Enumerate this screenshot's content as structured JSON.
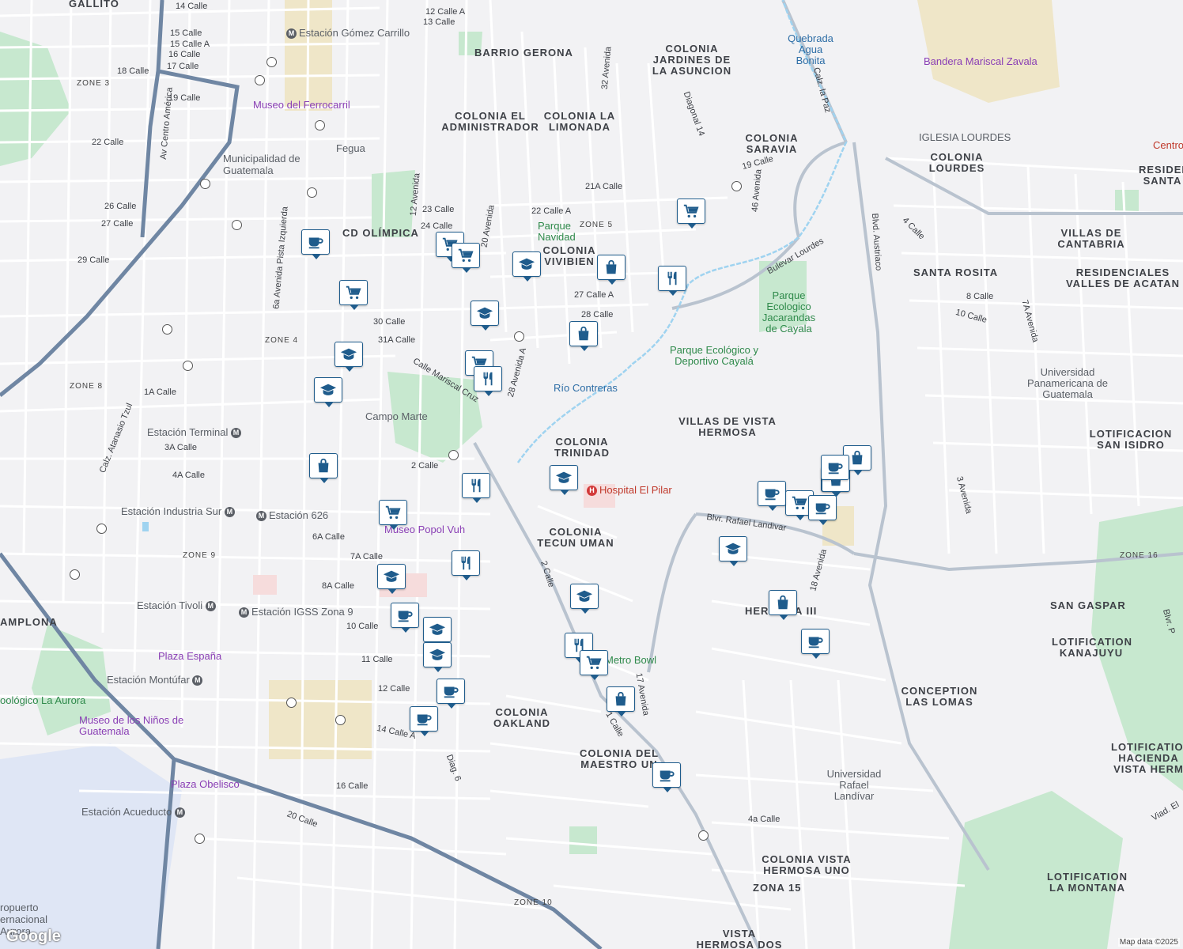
{
  "map": {
    "attribution": "Map data ©2025",
    "logo": "Google",
    "colors": {
      "background": "#f2f2f4",
      "park": "#c7e8cf",
      "water": "#9fd3f0",
      "highway": "#6f86a3",
      "pin_border": "#1f5c8c",
      "hospital": "#c0392b",
      "museum": "#8a3fb5"
    }
  },
  "areas": [
    {
      "id": "barrio-gerona",
      "text": "BARRIO GERONA"
    },
    {
      "id": "colonia-jardines",
      "text": "COLONIA JARDINES DE LA ASUNCION"
    },
    {
      "id": "colonia-administrador",
      "text": "COLONIA EL ADMINISTRADOR"
    },
    {
      "id": "colonia-limonada",
      "text": "COLONIA LA LIMONADA"
    },
    {
      "id": "colonia-saravia",
      "text": "COLONIA SARAVIA"
    },
    {
      "id": "colonia-lourdes",
      "text": "COLONIA LOURDES"
    },
    {
      "id": "residen-santa",
      "text": "RESIDEN SANTA"
    },
    {
      "id": "villas-cantabria",
      "text": "VILLAS DE CANTABRIA"
    },
    {
      "id": "santa-rosita",
      "text": "SANTA ROSITA"
    },
    {
      "id": "valles-acatan",
      "text": "RESIDENCIALES VALLES DE ACATAN"
    },
    {
      "id": "cd-olimpica",
      "text": "CD OLÍMPICA"
    },
    {
      "id": "colonia-vivibien",
      "text": "COLONIA VIVIBIEN"
    },
    {
      "id": "villas-vista",
      "text": "VILLAS DE VISTA HERMOSA"
    },
    {
      "id": "lot-san-isidro",
      "text": "LOTIFICACION SAN ISIDRO"
    },
    {
      "id": "colonia-trinidad",
      "text": "COLONIA TRINIDAD"
    },
    {
      "id": "colonia-tecun",
      "text": "COLONIA TECUN UMAN"
    },
    {
      "id": "hermosa-iii",
      "text": "HERMOSA III"
    },
    {
      "id": "san-gaspar",
      "text": "SAN GASPAR"
    },
    {
      "id": "lot-kanajuyu",
      "text": "LOTIFICATION KANAJUYU"
    },
    {
      "id": "conception-lomas",
      "text": "CONCEPTION LAS LOMAS"
    },
    {
      "id": "colonia-oakland",
      "text": "COLONIA OAKLAND"
    },
    {
      "id": "colonia-maestro",
      "text": "COLONIA DEL MAESTRO UN"
    },
    {
      "id": "lot-hacienda",
      "text": "LOTIFICATION HACIENDA VISTA HERM"
    },
    {
      "id": "colonia-vista-uno",
      "text": "COLONIA VISTA HERMOSA UNO"
    },
    {
      "id": "zona-15",
      "text": "ZONA 15"
    },
    {
      "id": "vista-dos",
      "text": "VISTA HERMOSA DOS"
    },
    {
      "id": "lot-montana",
      "text": "LOTIFICATION LA MONTANA"
    },
    {
      "id": "gallito",
      "text": "GALLITO"
    },
    {
      "id": "amplona",
      "text": "AMPLONA"
    }
  ],
  "pois": [
    {
      "id": "museo-ferrocarril",
      "text": "Museo del Ferrocarril",
      "kind": "museum"
    },
    {
      "id": "municipalidad",
      "text": "Municipalidad de Guatemala",
      "kind": "gov"
    },
    {
      "id": "fegua",
      "text": "Fegua",
      "kind": "transit"
    },
    {
      "id": "estacion-gomez",
      "text": "Estación Gómez Carrillo",
      "kind": "station"
    },
    {
      "id": "estacion-terminal",
      "text": "Estación Terminal",
      "kind": "station"
    },
    {
      "id": "estacion-industria",
      "text": "Estación Industria Sur",
      "kind": "station"
    },
    {
      "id": "estacion-626",
      "text": "Estación 626",
      "kind": "station"
    },
    {
      "id": "estacion-tivoli",
      "text": "Estación Tivoli",
      "kind": "station"
    },
    {
      "id": "estacion-igss",
      "text": "Estación IGSS Zona 9",
      "kind": "station"
    },
    {
      "id": "estacion-montufar",
      "text": "Estación Montúfar",
      "kind": "station"
    },
    {
      "id": "estacion-acueducto",
      "text": "Estación Acueducto",
      "kind": "station"
    },
    {
      "id": "campo-marte",
      "text": "Campo Marte",
      "kind": "park"
    },
    {
      "id": "museo-popol",
      "text": "Museo Popol Vuh",
      "kind": "museum"
    },
    {
      "id": "plaza-espana",
      "text": "Plaza España",
      "kind": "museum"
    },
    {
      "id": "plaza-obelisco",
      "text": "Plaza Obelisco",
      "kind": "museum"
    },
    {
      "id": "museo-ninos",
      "text": "Museo de los Niños de Guatemala",
      "kind": "museum"
    },
    {
      "id": "zoologico",
      "text": "oológico La Aurora",
      "kind": "park"
    },
    {
      "id": "parque-navidad",
      "text": "Parque Navidad",
      "kind": "park"
    },
    {
      "id": "rio-contreras",
      "text": "Río Contreras",
      "kind": "water"
    },
    {
      "id": "quebrada",
      "text": "Quebrada Agua Bonita",
      "kind": "water"
    },
    {
      "id": "parque-jacarandas",
      "text": "Parque Ecologico Jacarandas de Cayala",
      "kind": "park"
    },
    {
      "id": "parque-cayala",
      "text": "Parque Ecológico y Deportivo Cayalá",
      "kind": "park"
    },
    {
      "id": "hospital-pilar",
      "text": "Hospital El Pilar",
      "kind": "hospital"
    },
    {
      "id": "metro-bowl",
      "text": "Metro Bowl",
      "kind": "park"
    },
    {
      "id": "bandera",
      "text": "Bandera Mariscal Zavala",
      "kind": "museum"
    },
    {
      "id": "iglesia-lourdes",
      "text": "IGLESIA LOURDES",
      "kind": "church"
    },
    {
      "id": "upana",
      "text": "Universidad Panamericana de Guatemala",
      "kind": "museum"
    },
    {
      "id": "url",
      "text": "Universidad Rafael Landívar",
      "kind": "school"
    },
    {
      "id": "centro",
      "text": "Centro",
      "kind": "red"
    },
    {
      "id": "aeropuerto",
      "text": "ropuerto ernacional Aurora",
      "kind": "airport"
    }
  ],
  "streets": [
    {
      "id": "s1",
      "text": "14 Calle"
    },
    {
      "id": "s2",
      "text": "12 Calle A"
    },
    {
      "id": "s3",
      "text": "13 Calle"
    },
    {
      "id": "s4",
      "text": "15 Calle"
    },
    {
      "id": "s5",
      "text": "15 Calle A"
    },
    {
      "id": "s6",
      "text": "16 Calle"
    },
    {
      "id": "s7",
      "text": "17 Calle"
    },
    {
      "id": "s8",
      "text": "18 Calle"
    },
    {
      "id": "s9",
      "text": "19 Calle"
    },
    {
      "id": "s10",
      "text": "22 Calle"
    },
    {
      "id": "s11",
      "text": "26 Calle"
    },
    {
      "id": "s12",
      "text": "27 Calle"
    },
    {
      "id": "s13",
      "text": "29 Calle"
    },
    {
      "id": "s14",
      "text": "30 Calle"
    },
    {
      "id": "s15",
      "text": "31A Calle"
    },
    {
      "id": "s16",
      "text": "1A Calle"
    },
    {
      "id": "s17",
      "text": "2 Calle"
    },
    {
      "id": "s18",
      "text": "3A Calle"
    },
    {
      "id": "s19",
      "text": "4A Calle"
    },
    {
      "id": "s20",
      "text": "6A Calle"
    },
    {
      "id": "s21",
      "text": "7A Calle"
    },
    {
      "id": "s22",
      "text": "8A Calle"
    },
    {
      "id": "s23",
      "text": "10 Calle"
    },
    {
      "id": "s24",
      "text": "11 Calle"
    },
    {
      "id": "s25",
      "text": "12 Calle"
    },
    {
      "id": "s26",
      "text": "14 Calle A"
    },
    {
      "id": "s27",
      "text": "16 Calle"
    },
    {
      "id": "s28",
      "text": "20 Calle"
    },
    {
      "id": "s29",
      "text": "Calle Mariscal Cruz"
    },
    {
      "id": "s30",
      "text": "Blvr. Rafael Landivar"
    },
    {
      "id": "s31",
      "text": "Bulevar Lourdes"
    },
    {
      "id": "s32",
      "text": "Calz. la Paz"
    },
    {
      "id": "s33",
      "text": "Blvd. Austriaco"
    },
    {
      "id": "s34",
      "text": "Diagonal 14"
    },
    {
      "id": "s35",
      "text": "Diag. 6"
    },
    {
      "id": "s36",
      "text": "Calz. Atanasio Tzul"
    },
    {
      "id": "s37",
      "text": "Av Centro América"
    },
    {
      "id": "s38",
      "text": "6a Avenida Pista Izquierda"
    },
    {
      "id": "s39",
      "text": "20 Avenida"
    },
    {
      "id": "s40",
      "text": "12 Avenida"
    },
    {
      "id": "s41",
      "text": "28 Avenida A"
    },
    {
      "id": "s42",
      "text": "32 Avenida"
    },
    {
      "id": "s43",
      "text": "22 Calle A"
    },
    {
      "id": "s44",
      "text": "23 Calle"
    },
    {
      "id": "s45",
      "text": "24 Calle"
    },
    {
      "id": "s46",
      "text": "21A Calle"
    },
    {
      "id": "s47",
      "text": "2 Calle"
    },
    {
      "id": "s48",
      "text": "17 Avenida"
    },
    {
      "id": "s49",
      "text": "18 Avenida"
    },
    {
      "id": "s50",
      "text": "Viad. El"
    },
    {
      "id": "s51",
      "text": "8 Calle"
    },
    {
      "id": "s52",
      "text": "10 Calle"
    },
    {
      "id": "s53",
      "text": "4 Calle"
    },
    {
      "id": "s54",
      "text": "3 Avenida"
    },
    {
      "id": "s55",
      "text": "7A Avenida"
    },
    {
      "id": "s56",
      "text": "46 Avenida"
    },
    {
      "id": "s57",
      "text": "19 Calle"
    },
    {
      "id": "s58",
      "text": "28 Calle"
    },
    {
      "id": "s59",
      "text": "27 Calle A"
    },
    {
      "id": "s60",
      "text": "Blvr. P"
    },
    {
      "id": "s61",
      "text": "4a Calle"
    },
    {
      "id": "s62",
      "text": "1 Calle"
    }
  ],
  "zones": [
    {
      "id": "z3",
      "text": "ZONE 3"
    },
    {
      "id": "z4",
      "text": "ZONE 4"
    },
    {
      "id": "z5",
      "text": "ZONE 5"
    },
    {
      "id": "z8",
      "text": "ZONE 8"
    },
    {
      "id": "z9",
      "text": "ZONE 9"
    },
    {
      "id": "z10",
      "text": "ZONE 10"
    },
    {
      "id": "z16",
      "text": "ZONE 16"
    }
  ],
  "markers": [
    {
      "icon": "cup-icon"
    },
    {
      "icon": "cart-icon"
    },
    {
      "icon": "cart-icon"
    },
    {
      "icon": "cart-icon"
    },
    {
      "icon": "school-icon"
    },
    {
      "icon": "bag-icon"
    },
    {
      "icon": "restaurant-icon"
    },
    {
      "icon": "cart-icon"
    },
    {
      "icon": "school-icon"
    },
    {
      "icon": "school-icon"
    },
    {
      "icon": "bag-icon"
    },
    {
      "icon": "cart-icon"
    },
    {
      "icon": "restaurant-icon"
    },
    {
      "icon": "school-icon"
    },
    {
      "icon": "bag-icon"
    },
    {
      "icon": "restaurant-icon"
    },
    {
      "icon": "school-icon"
    },
    {
      "icon": "cart-icon"
    },
    {
      "icon": "restaurant-icon"
    },
    {
      "icon": "school-icon"
    },
    {
      "icon": "cup-icon"
    },
    {
      "icon": "school-icon"
    },
    {
      "icon": "school-icon"
    },
    {
      "icon": "cup-icon"
    },
    {
      "icon": "cup-icon"
    },
    {
      "icon": "school-icon"
    },
    {
      "icon": "restaurant-icon"
    },
    {
      "icon": "cart-icon"
    },
    {
      "icon": "bag-icon"
    },
    {
      "icon": "cup-icon"
    },
    {
      "icon": "cart-icon"
    },
    {
      "icon": "cup-icon"
    },
    {
      "icon": "cart-icon"
    },
    {
      "icon": "cup-icon"
    },
    {
      "icon": "cup-icon"
    },
    {
      "icon": "bag-icon"
    },
    {
      "icon": "bag-icon"
    },
    {
      "icon": "school-icon"
    },
    {
      "icon": "bag-icon"
    },
    {
      "icon": "cup-icon"
    }
  ]
}
